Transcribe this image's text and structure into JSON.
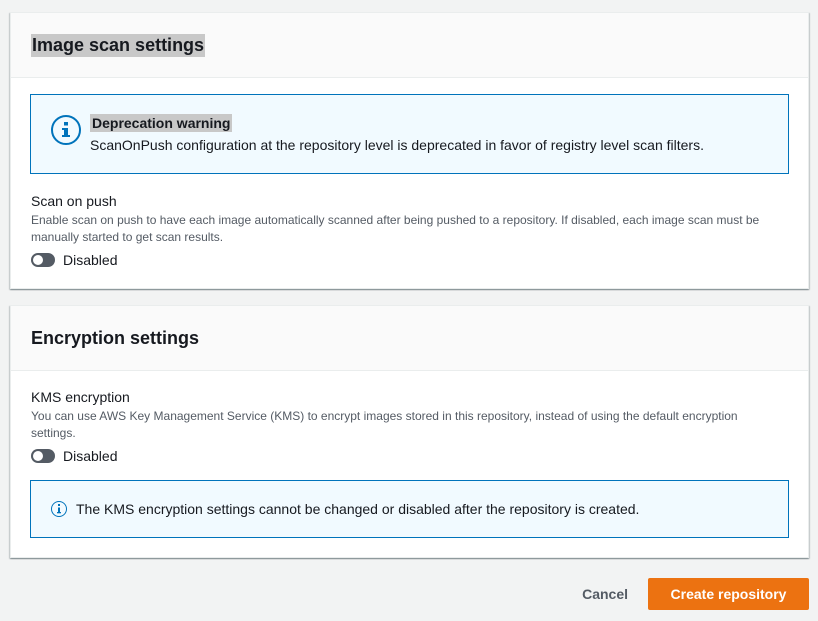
{
  "image_scan": {
    "title": "Image scan settings",
    "alert": {
      "icon": "info-circle-icon",
      "title": "Deprecation warning",
      "text": "ScanOnPush configuration at the repository level is deprecated in favor of registry level scan filters."
    },
    "scan_on_push": {
      "label": "Scan on push",
      "description_line1": "Enable scan on push to have each image automatically scanned after being pushed to a repository. If disabled, each image scan must be",
      "description_line2": "manually started to get scan results.",
      "toggle_state": "Disabled"
    }
  },
  "encryption": {
    "title": "Encryption settings",
    "kms": {
      "label": "KMS encryption",
      "description_line1": "You can use AWS Key Management Service (KMS) to encrypt images stored in this repository, instead of using the default encryption",
      "description_line2": "settings.",
      "toggle_state": "Disabled"
    },
    "info_alert": {
      "icon": "info-circle-icon",
      "text": "The KMS encryption settings cannot be changed or disabled after the repository is created."
    }
  },
  "actions": {
    "cancel_label": "Cancel",
    "create_label": "Create repository"
  },
  "colors": {
    "primary": "#ec7211",
    "info": "#0073bb",
    "toggle_off": "#545b64"
  }
}
